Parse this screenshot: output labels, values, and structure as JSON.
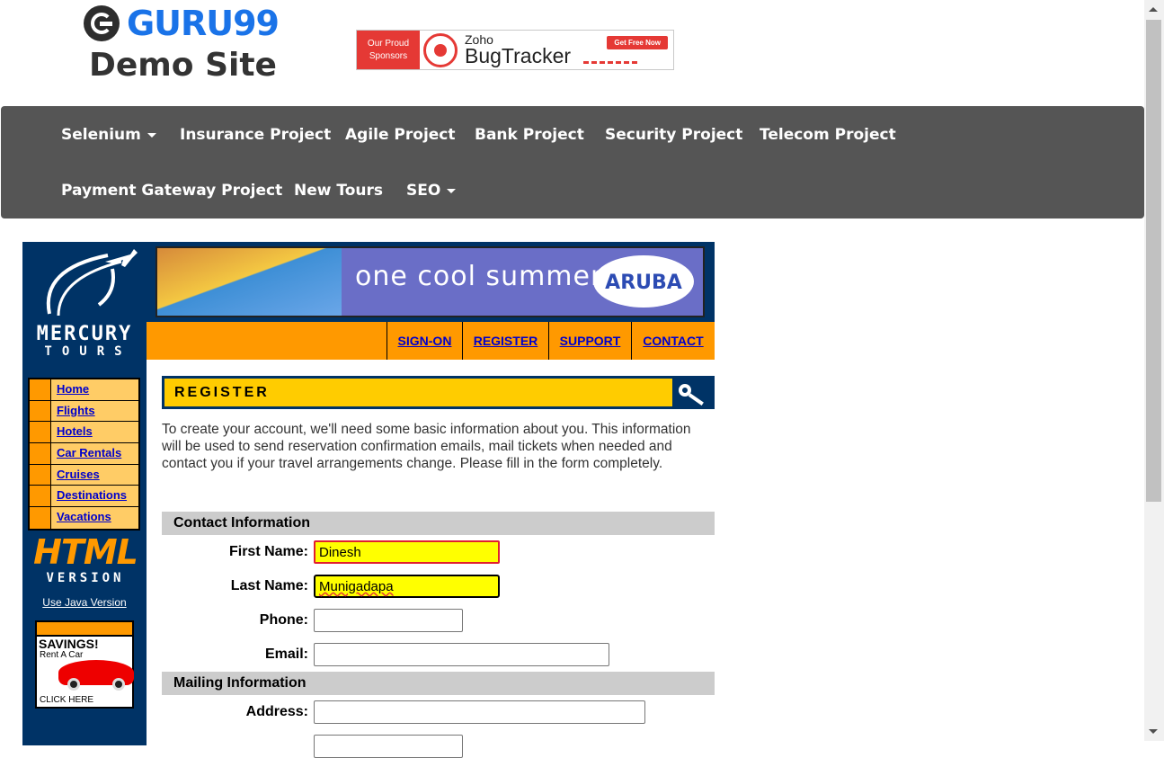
{
  "header": {
    "logo_text": "GURU99",
    "site_subtitle": "Demo Site",
    "sponsor": {
      "left_text_1": "Our Proud",
      "left_text_2": "Sponsors",
      "brand_small": "Zoho",
      "brand_large": "BugTracker",
      "cta": "Get Free Now"
    }
  },
  "nav": {
    "row1": [
      {
        "label": "Selenium",
        "dropdown": true
      },
      {
        "label": "Insurance Project",
        "dropdown": false
      },
      {
        "label": "Agile Project",
        "dropdown": false
      },
      {
        "label": "Bank Project",
        "dropdown": false
      },
      {
        "label": "Security Project",
        "dropdown": false
      },
      {
        "label": "Telecom Project",
        "dropdown": false
      }
    ],
    "row2": [
      {
        "label": "Payment Gateway Project",
        "dropdown": false
      },
      {
        "label": "New Tours",
        "dropdown": false
      },
      {
        "label": "SEO",
        "dropdown": true
      }
    ]
  },
  "mercury": {
    "logo_title": "MERCURY",
    "logo_sub": "TOURS",
    "side_links": [
      "Home",
      "Flights",
      "Hotels",
      "Car Rentals",
      "Cruises",
      "Destinations",
      "Vacations"
    ],
    "html_version_1": "HTML",
    "html_version_2": "VERSION",
    "java_link": "Use Java Version",
    "savings_ad": {
      "title": "SAVINGS!",
      "subtitle": "Rent A Car",
      "cta": "CLICK HERE"
    },
    "banner_text": "one cool summer",
    "banner_brand": "ARUBA",
    "top_links": [
      "SIGN-ON",
      "REGISTER",
      "SUPPORT",
      "CONTACT"
    ]
  },
  "register": {
    "title": "REGISTER",
    "intro": "To create your account, we'll need some basic information about you. This information will be used to send reservation confirmation emails, mail tickets when needed and contact you if your travel arrangements change. Please fill in the form completely.",
    "contact_header": "Contact Information",
    "mailing_header": "Mailing Information",
    "fields": {
      "first_name": {
        "label": "First Name:",
        "value": "Dinesh"
      },
      "last_name": {
        "label": "Last Name:",
        "value": "Munigadapa"
      },
      "phone": {
        "label": "Phone:",
        "value": ""
      },
      "email": {
        "label": "Email:",
        "value": ""
      },
      "address": {
        "label": "Address:",
        "value": ""
      }
    }
  },
  "colors": {
    "nav_bg": "#555555",
    "brand_blue": "#1a73e8",
    "mercury_navy": "#003366",
    "mercury_orange": "#ff9900",
    "mercury_yellow": "#ffcc00",
    "autofill_yellow": "#ffff00"
  }
}
